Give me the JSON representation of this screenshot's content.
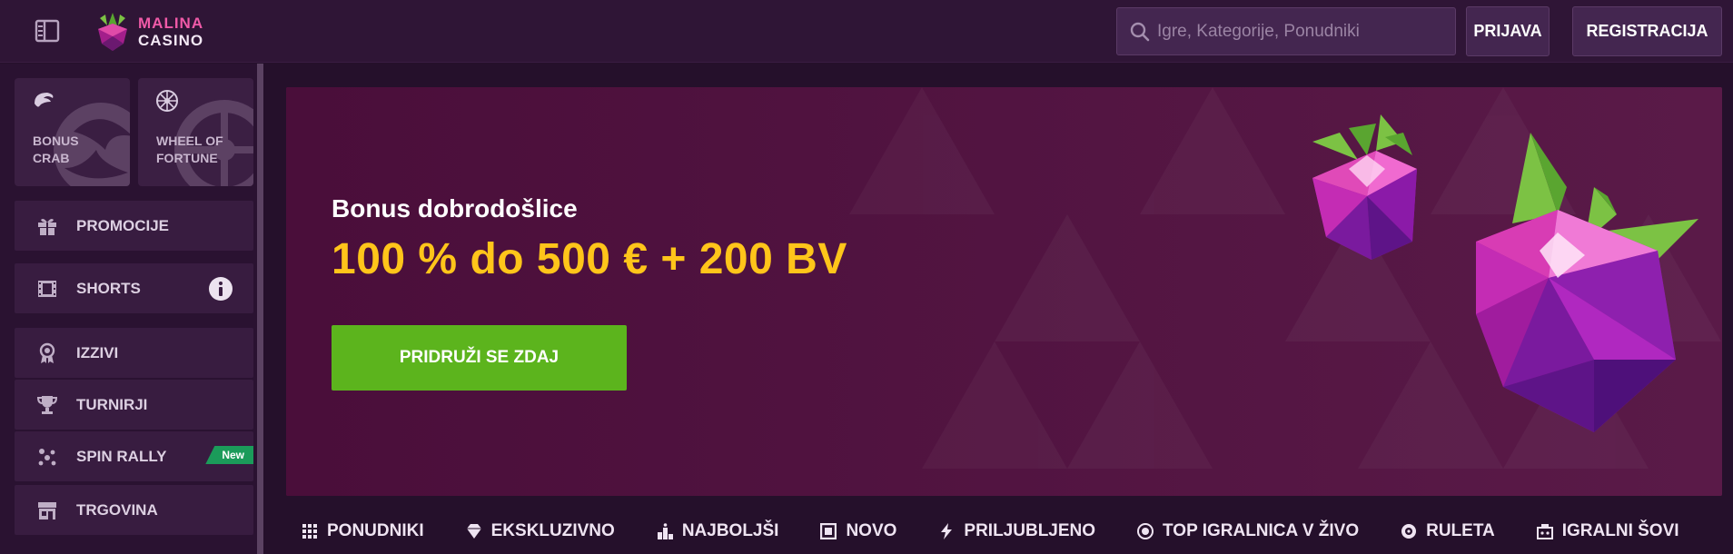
{
  "header": {
    "logo_line1": "MALINA",
    "logo_line2": "CASINO",
    "search_placeholder": "Igre, Kategorije, Ponudniki",
    "login_label": "PRIJAVA",
    "register_label": "REGISTRACIJA"
  },
  "sidebar": {
    "tiles": [
      {
        "label": "BONUS CRAB",
        "icon": "crab-claw-icon"
      },
      {
        "label": "WHEEL OF FORTUNE",
        "icon": "wheel-icon"
      }
    ],
    "items": [
      {
        "label": "PROMOCIJE",
        "icon": "gift-icon"
      },
      {
        "label": "SHORTS",
        "icon": "film-icon",
        "info": true
      },
      {
        "label": "IZZIVI",
        "icon": "medal-icon"
      },
      {
        "label": "TURNIRJI",
        "icon": "trophy-icon"
      },
      {
        "label": "SPIN RALLY",
        "icon": "sparkles-icon",
        "badge": "New"
      },
      {
        "label": "TRGOVINA",
        "icon": "store-icon"
      }
    ]
  },
  "banner": {
    "kicker": "Bonus dobrodošlice",
    "offer": "100 % do 500 € + 200 BV",
    "cta_label": "PRIDRUŽI SE ZDAJ"
  },
  "categories": [
    {
      "label": "PONUDNIKI",
      "icon": "grid-icon"
    },
    {
      "label": "EKSKLUZIVNO",
      "icon": "diamond-icon"
    },
    {
      "label": "NAJBOLJŠI",
      "icon": "podium-icon"
    },
    {
      "label": "NOVO",
      "icon": "new-box-icon"
    },
    {
      "label": "PRILJUBLJENO",
      "icon": "lightning-icon"
    },
    {
      "label": "TOP IGRALNICA V ŽIVO",
      "icon": "live-chip-icon"
    },
    {
      "label": "RULETA",
      "icon": "roulette-icon"
    },
    {
      "label": "IGRALNI ŠOVI",
      "icon": "game-show-icon"
    }
  ],
  "colors": {
    "accent_yellow": "#ffc51a",
    "cta_green": "#5cb41d",
    "badge_green": "#1b9b5a",
    "logo_pink": "#f05aa8"
  }
}
